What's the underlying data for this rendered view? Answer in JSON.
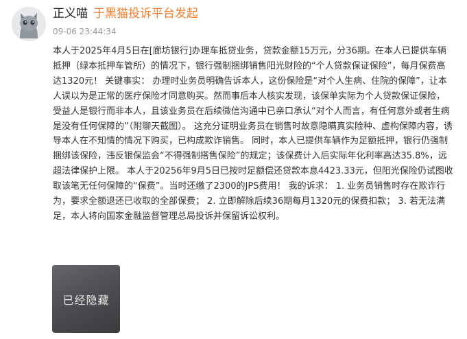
{
  "post": {
    "username": "正义喵",
    "source": "于黑猫投诉平台发起",
    "timestamp": "09-06 23:44:34",
    "body": "本人于2025年4月5日在[廊坊银行]办理车抵贷业务，贷款金额15万元，分36期。在本人已提供车辆抵押（绿本抵押车管所）的情况下，银行强制捆绑销售阳光财险的“个人贷款保证保险”，每月保费高达1320元！ 关键事实： 办理时业务员明确告诉本人，这份保险是“对个人生病、住院的保障”，让本人误以为是正常的医疗保险才同意购买。然而事后本人核实发现，该保单实际为个人贷款保证保险，受益人是银行而非本人，且该业务员在后续微信沟通中已亲口承认“对个人而言，有任何意外或者生病是没有任何保障的”（附聊天截图）。 这充分证明业务员在销售时故意隐瞒真实险种、虚构保障内容，诱导本人在不知情的情况下购买，已构成欺诈销售。 同时，本人已提供车辆作为足额抵押，银行仍强制捆绑该保险，违反银保监会“不得强制搭售保险”的规定；该保费计入后实际年化利率高达35.8%，远超法律保护上限。 本人于20256年9月5日已按时足额偿还贷款本息4423.33元，但阳光保险仍试图收取该笔无任何保障的“保费”。当时还缴了2300的JPS费用！ 我的诉求： 1. 业务员销售时存在欺诈行为，要求全额退还已收取的全部保费； 2. 立即解除后续36期每月1320元的保费扣款； 3. 若无法满足，本人将向国家金融监督管理总局投诉并保留诉讼权利。",
    "hidden_image_label": "已经隐藏"
  },
  "icons": {
    "avatar": "cat-avatar-icon"
  },
  "colors": {
    "source": "#ef7f2f",
    "timestamp": "#999999",
    "text": "#333333"
  }
}
